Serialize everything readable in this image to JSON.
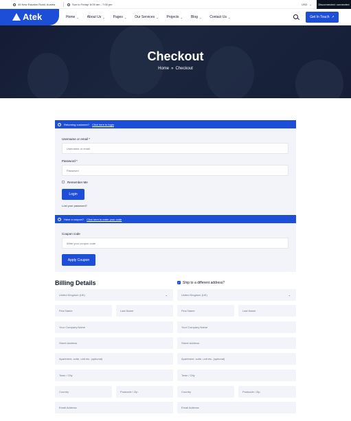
{
  "topbar": {
    "address": "45 New Eskaton Road, Austria",
    "hours": "Sun to Friday: 8:00 am - 7:00 pm",
    "currency": "USD",
    "status": "Disconnected: connected"
  },
  "header": {
    "logo_text": "Atek",
    "nav": [
      {
        "label": "Home"
      },
      {
        "label": "About Us"
      },
      {
        "label": "Pages"
      },
      {
        "label": "Our Services"
      },
      {
        "label": "Projects"
      },
      {
        "label": "Blog"
      },
      {
        "label": "Contact Us"
      }
    ],
    "cta": "Get In Touch"
  },
  "hero": {
    "title": "Checkout",
    "breadcrumb": {
      "home": "Home",
      "separator": "»",
      "current": "Checkout"
    }
  },
  "login_notice": {
    "text": "Returning customer?",
    "link": "Click here to login"
  },
  "login_form": {
    "username_label": "Username or email *",
    "username_placeholder": "Username or email",
    "password_label": "Password *",
    "password_placeholder": "Password",
    "remember": "Remember Me",
    "login_button": "Login",
    "lost_password": "Lost your password?"
  },
  "coupon_notice": {
    "text": "Have a coupon?",
    "link": "Click here to enter your code"
  },
  "coupon_form": {
    "label": "Coupon code",
    "placeholder": "Write your coupon code",
    "button": "Apply Coupon"
  },
  "billing": {
    "title": "Billing Details",
    "country": "United Kingdom (UK)",
    "first_name": "First Name",
    "last_name": "Last Name",
    "company": "Your Company Name",
    "street": "Street Address",
    "apartment": "Apartment, suite, unit etc. (optional)",
    "town": "Town / City",
    "county": "Country",
    "postcode": "Postcode / Zip",
    "email": "Email Address"
  },
  "shipping": {
    "ship_label": "Ship to a different address?",
    "country": "United Kingdom (UK)",
    "first_name": "First Name",
    "last_name": "Last Name",
    "company": "Your Company Name",
    "street": "Street Address",
    "apartment": "Apartment, suite, unit etc. (optional)",
    "town": "Town / City",
    "county": "Country",
    "postcode": "Postcode / Zip",
    "email": "Email Address"
  }
}
